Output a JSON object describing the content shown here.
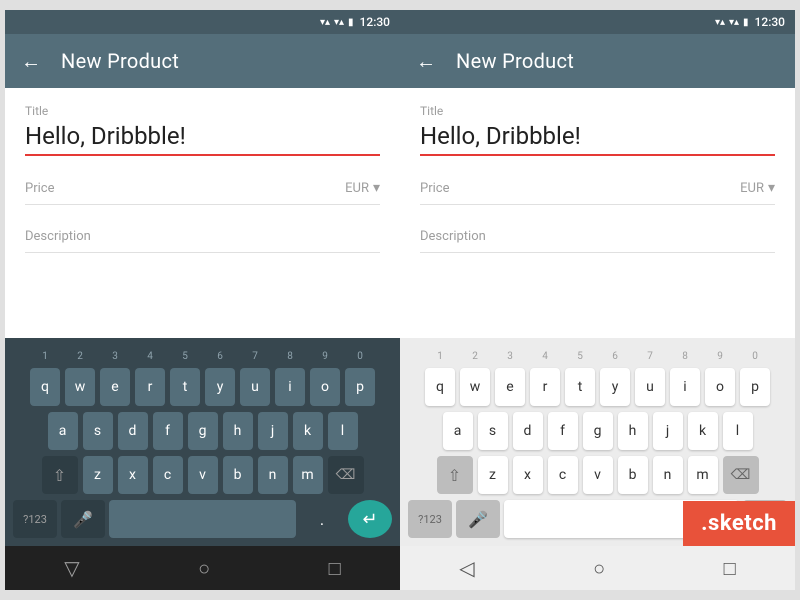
{
  "phones": [
    {
      "id": "dark-keyboard",
      "statusBar": {
        "time": "12:30",
        "wifiIcon": "▾▾",
        "signalIcon": "▾▾",
        "batteryIcon": "▮"
      },
      "topBar": {
        "backLabel": "←",
        "title": "New Product"
      },
      "form": {
        "titleLabel": "Title",
        "titleValue": "Hello, Dribbble!",
        "priceLabel": "Price",
        "currencyLabel": "EUR",
        "descriptionLabel": "Description"
      },
      "keyboardTheme": "dark",
      "numbers": [
        "1",
        "2",
        "3",
        "4",
        "5",
        "6",
        "7",
        "8",
        "9",
        "0"
      ],
      "row1": [
        "q",
        "w",
        "e",
        "r",
        "t",
        "y",
        "u",
        "i",
        "o",
        "p"
      ],
      "row2": [
        "a",
        "s",
        "d",
        "f",
        "g",
        "h",
        "j",
        "k",
        "l"
      ],
      "row3": [
        "z",
        "x",
        "c",
        "v",
        "b",
        "n",
        "m"
      ],
      "bottomNav": {
        "back": "▽",
        "home": "○",
        "recent": "□"
      }
    },
    {
      "id": "light-keyboard",
      "statusBar": {
        "time": "12:30",
        "wifiIcon": "▾▾",
        "signalIcon": "▾▾",
        "batteryIcon": "▮"
      },
      "topBar": {
        "backLabel": "←",
        "title": "New Product"
      },
      "form": {
        "titleLabel": "Title",
        "titleValue": "Hello, Dribbble!",
        "priceLabel": "Price",
        "currencyLabel": "EUR",
        "descriptionLabel": "Description"
      },
      "keyboardTheme": "light",
      "numbers": [
        "1",
        "2",
        "3",
        "4",
        "5",
        "6",
        "7",
        "8",
        "9",
        "0"
      ],
      "row1": [
        "q",
        "w",
        "e",
        "r",
        "t",
        "y",
        "u",
        "i",
        "o",
        "p"
      ],
      "row2": [
        "a",
        "s",
        "d",
        "f",
        "g",
        "h",
        "j",
        "k",
        "l"
      ],
      "row3": [
        "z",
        "x",
        "c",
        "v",
        "b",
        "n",
        "m"
      ],
      "bottomNav": {
        "back": "◁",
        "home": "○",
        "recent": "□"
      },
      "sketchBadge": ".sketch"
    }
  ]
}
